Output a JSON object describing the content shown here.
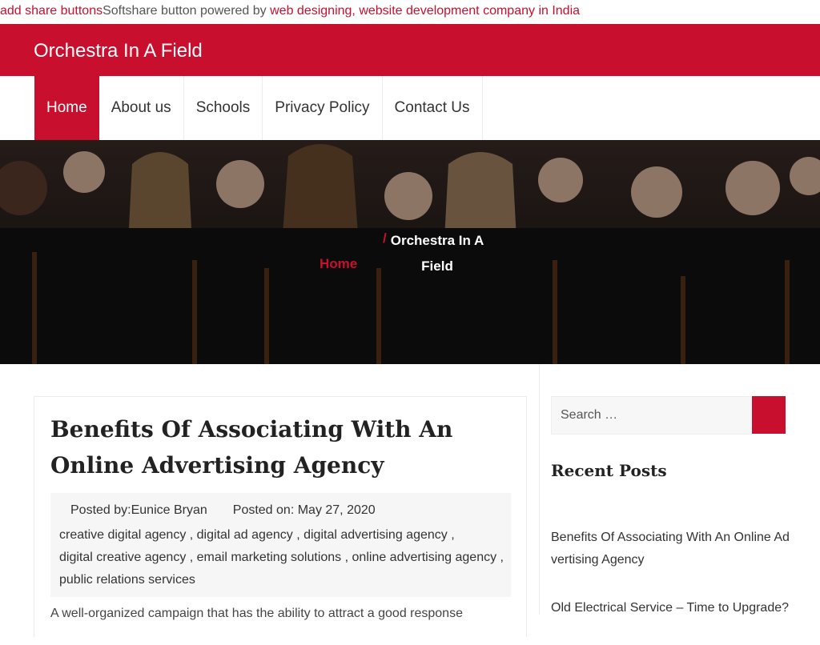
{
  "share_bar": {
    "link1": "add share buttons",
    "text": "Softshare button powered by ",
    "link2": "web designing, website development company in India"
  },
  "site": {
    "title": "Orchestra In A Field"
  },
  "nav": {
    "items": [
      {
        "label": "Home",
        "active": true
      },
      {
        "label": "About us"
      },
      {
        "label": "Schools"
      },
      {
        "label": "Privacy Policy"
      },
      {
        "label": "Contact Us"
      }
    ]
  },
  "hero": {
    "breadcrumb_home": "Home",
    "breadcrumb_sep": "/",
    "breadcrumb_current": "Orchestra In A Field"
  },
  "article": {
    "title": "Benefits Of Associating With An Online Advertising Agency",
    "posted_by": "Posted by:Eunice Bryan",
    "posted_on": "Posted on: May 27, 2020",
    "tags": [
      "creative digital agency",
      "digital ad agency",
      "digital advertising agency",
      "digital creative agency",
      "email marketing solutions",
      "online advertising agency",
      "public relations services"
    ],
    "excerpt": "A well-organized campaign that has the ability to attract a good response"
  },
  "sidebar": {
    "search_placeholder": "Search …",
    "recent_title": "Recent Posts",
    "recent_posts": [
      "Benefits Of Associating With An Online Advertising Agency",
      "Old Electrical Service – Time to Upgrade?"
    ]
  },
  "colors": {
    "accent": "#c8102e"
  }
}
